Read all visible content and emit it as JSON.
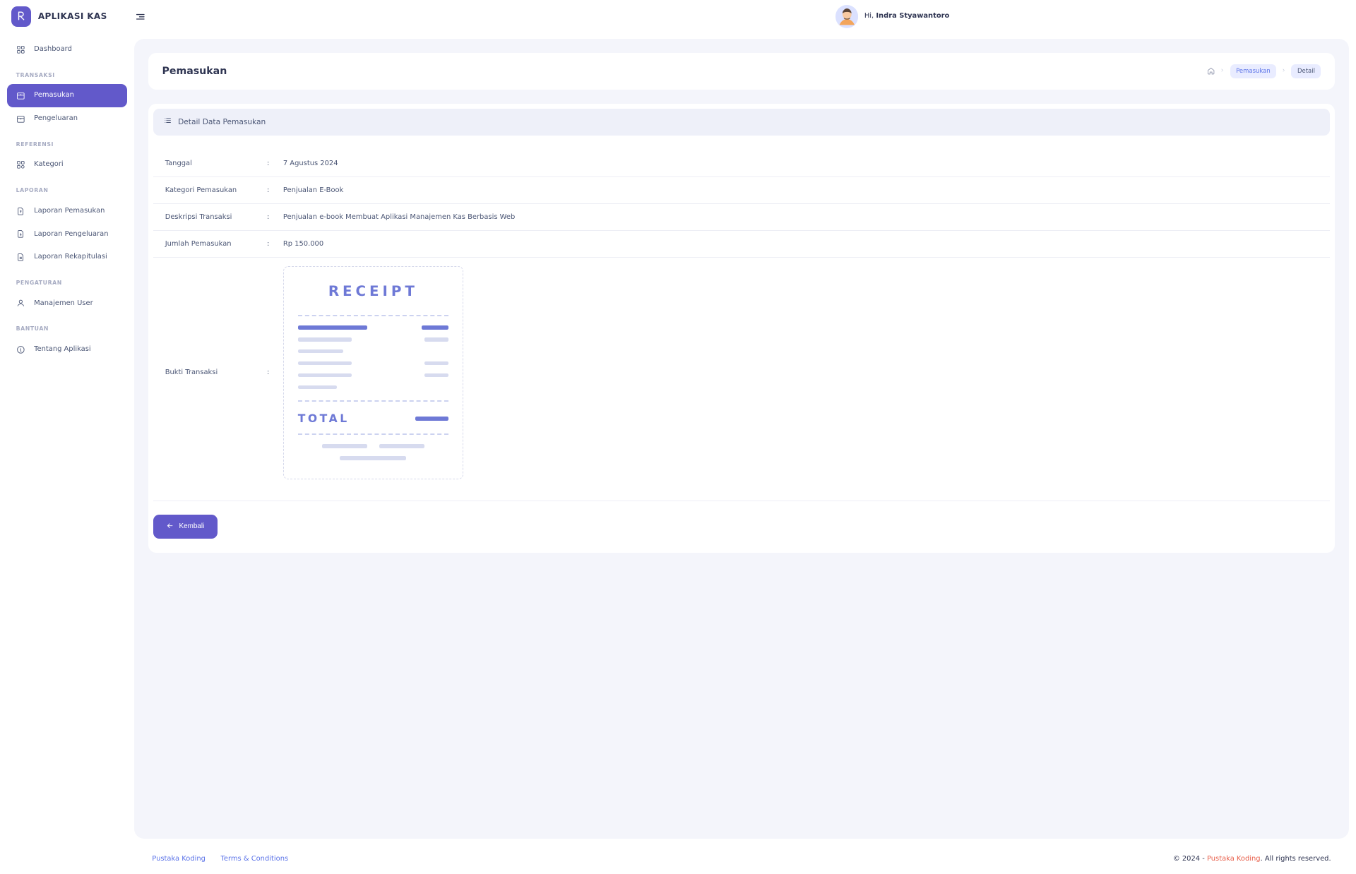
{
  "header": {
    "app_name": "APLIKASI KAS",
    "greeting_prefix": "Hi, ",
    "username": "Indra Styawantoro"
  },
  "sidebar": {
    "item_dashboard": "Dashboard",
    "group_transaksi": "TRANSAKSI",
    "item_pemasukan": "Pemasukan",
    "item_pengeluaran": "Pengeluaran",
    "group_referensi": "REFERENSI",
    "item_kategori": "Kategori",
    "group_laporan": "LAPORAN",
    "item_lap_pemasukan": "Laporan Pemasukan",
    "item_lap_pengeluaran": "Laporan Pengeluaran",
    "item_lap_rekapitulasi": "Laporan Rekapitulasi",
    "group_pengaturan": "PENGATURAN",
    "item_user": "Manajemen User",
    "group_bantuan": "BANTUAN",
    "item_tentang": "Tentang Aplikasi"
  },
  "page": {
    "title": "Pemasukan",
    "breadcrumb_pemasukan": "Pemasukan",
    "breadcrumb_detail": "Detail",
    "card_title": "Detail Data Pemasukan"
  },
  "detail": {
    "tanggal_label": "Tanggal",
    "tanggal_value": "7 Agustus 2024",
    "kategori_label": "Kategori Pemasukan",
    "kategori_value": "Penjualan E-Book",
    "deskripsi_label": "Deskripsi Transaksi",
    "deskripsi_value": "Penjualan e-book Membuat Aplikasi Manajemen Kas Berbasis Web",
    "jumlah_label": "Jumlah Pemasukan",
    "jumlah_value": "Rp 150.000",
    "bukti_label": "Bukti Transaksi",
    "sep": ":"
  },
  "receipt": {
    "title": "RECEIPT",
    "total": "TOTAL"
  },
  "actions": {
    "back": "Kembali"
  },
  "footer": {
    "link1": "Pustaka Koding",
    "link2": "Terms & Conditions",
    "copyright_prefix": "© 2024 - ",
    "brand": "Pustaka Koding",
    "copyright_suffix": ". All rights reserved."
  }
}
